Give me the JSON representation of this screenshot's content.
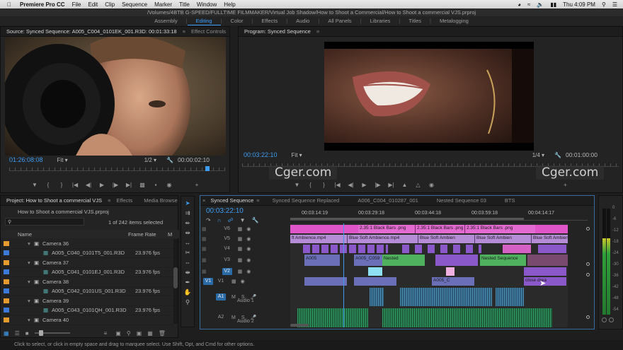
{
  "menubar": {
    "app": "Premiere Pro CC",
    "items": [
      "File",
      "Edit",
      "Clip",
      "Sequence",
      "Marker",
      "Title",
      "Window",
      "Help"
    ],
    "clock": "Thu 4:09 PM"
  },
  "title_path": "/Volumes/4BTB G-SPEED/FULLTIME FILMMAKER/Virtual Job Shadow/How to Shoot a Commercial/How to Shoot a commercial VJS.prproj",
  "workspaces": [
    "Assembly",
    "Editing",
    "Color",
    "Effects",
    "Audio",
    "All Panels",
    "Libraries",
    "Titles",
    "Metalogging"
  ],
  "workspace_active": "Editing",
  "source": {
    "tabs": [
      "Source: Synced Sequence: A005_C004_0101EK_001.R3D: 00:01:33:18",
      "Effect Controls",
      "Ai"
    ],
    "timecode": "01:26:08:08",
    "fit": "Fit",
    "resolution": "1/2",
    "duration": "00:00:02:10"
  },
  "program": {
    "tab": "Program: Synced Sequence",
    "timecode": "00:03:22:10",
    "fit": "Fit",
    "resolution": "1/4",
    "duration": "00:01:00:00"
  },
  "watermarks": [
    "Cger.com",
    "Cger.com"
  ],
  "project": {
    "tabs": [
      "Project: How to Shoot a commercial VJS",
      "Effects",
      "Media Browse"
    ],
    "file": "How to Shoot a commercial VJS.prproj",
    "count": "1 of 242 items selected",
    "columns": [
      "Name",
      "Frame Rate",
      "M"
    ],
    "rows": [
      {
        "name": "Camera 36",
        "rate": "",
        "kind": "bin"
      },
      {
        "name": "A005_C040_0101T5_001.R3D",
        "rate": "23.976 fps",
        "kind": "clip"
      },
      {
        "name": "Camera 37",
        "rate": "",
        "kind": "bin"
      },
      {
        "name": "A005_C041_0101EJ_001.R3D",
        "rate": "23.976 fps",
        "kind": "clip"
      },
      {
        "name": "Camera 38",
        "rate": "",
        "kind": "bin"
      },
      {
        "name": "A005_C042_0101US_001.R3D",
        "rate": "23.976 fps",
        "kind": "clip"
      },
      {
        "name": "Camera 39",
        "rate": "",
        "kind": "bin"
      },
      {
        "name": "A005_C043_0101QH_001.R3D",
        "rate": "23.976 fps",
        "kind": "clip"
      },
      {
        "name": "Camera 40",
        "rate": "",
        "kind": "bin"
      }
    ]
  },
  "timeline": {
    "tabs": [
      "Synced Sequence",
      "Synced Sequence Replaced",
      "A006_C004_010287_001",
      "Nested Sequence 03",
      "BTS"
    ],
    "timecode": "00:03:22:10",
    "ruler": [
      "00:03:14:19",
      "00:03:29:18",
      "00:03:44:18",
      "00:03:59:18",
      "00:04:14:17"
    ],
    "tracks": [
      "V6",
      "V5",
      "V4",
      "V3",
      "V2",
      "V1",
      "A1",
      "A2"
    ],
    "audio_names": [
      "Audio 1",
      "Audio 2"
    ],
    "clip_labels": {
      "bars": "2.35:1 Black Bars .png",
      "ambience": "Blue Soft Ambience.mp4",
      "ambience_short": "ft Ambience.mp4",
      "ambience_cut": "Blue Soft Ambien",
      "nested": "Nested Sequence",
      "nested_short": "Nested",
      "a005": "A005",
      "a005_c059": "A005_C059",
      "a005_cut": "A005_C",
      "close": "close drea"
    },
    "meter_scale": [
      "0",
      "-6",
      "-12",
      "-18",
      "-24",
      "-30",
      "-36",
      "-42",
      "-48",
      "-54"
    ],
    "meter_level": 0.72
  },
  "tools": [
    "selection-tool",
    "track-select-tool",
    "ripple-tool",
    "rolling-tool",
    "rate-stretch-tool",
    "razor-tool",
    "slip-tool",
    "slide-tool",
    "pen-tool",
    "hand-tool",
    "zoom-tool"
  ],
  "status": "Click to select, or click in empty space and drag to marquee select. Use Shift, Opt, and Cmd for other options."
}
